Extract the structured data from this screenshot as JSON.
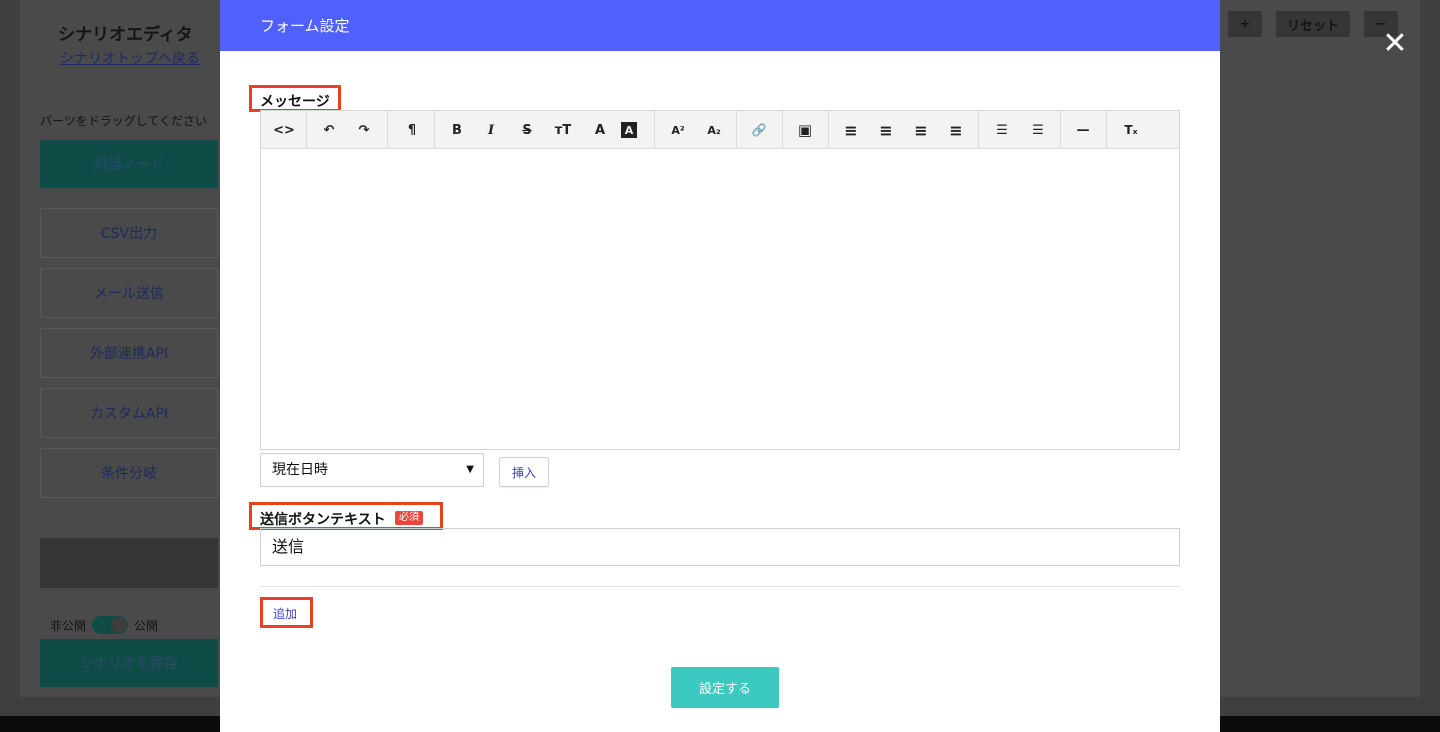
{
  "background_app": {
    "title": "シナリオエディタ",
    "back_link": "シナリオトップへ戻る",
    "parts_hint": "パーツをドラッグしてください",
    "parts": [
      {
        "label": "対話ノード"
      },
      {
        "label": "CSV出力"
      },
      {
        "label": "メール送信"
      },
      {
        "label": "外部連携API"
      },
      {
        "label": "カスタムAPI"
      },
      {
        "label": "条件分岐"
      }
    ],
    "dark_button_label": "",
    "toggle_off_label": "非公開",
    "toggle_on_label": "公開",
    "save_label": "シナリオを保存",
    "top_controls": {
      "plus": "+",
      "reset": "リセット",
      "minus": "−"
    }
  },
  "close_glyph": "✕",
  "modal": {
    "title": "フォーム設定",
    "message_label": "メッセージ",
    "toolbar_icons": [
      "code-view-icon",
      "undo-icon",
      "redo-icon",
      "paragraph-icon",
      "bold-icon",
      "italic-icon",
      "strikethrough-icon",
      "font-size-icon",
      "font-color-icon",
      "background-color-icon",
      "superscript-icon",
      "subscript-icon",
      "link-icon",
      "image-icon",
      "align-left-icon",
      "align-center-icon",
      "align-right-icon",
      "align-justify-icon",
      "unordered-list-icon",
      "ordered-list-icon",
      "horizontal-rule-icon",
      "clear-format-icon"
    ],
    "toolbar_glyphs": {
      "code": "<>",
      "undo": "↶",
      "redo": "↷",
      "paragraph": "¶",
      "bold": "B",
      "italic": "I",
      "strike": "S",
      "fontsize": "тT",
      "fontcolor": "A",
      "bgcolor": "A",
      "sup": "A²",
      "sub": "A₂",
      "link": "🔗",
      "image": "▣",
      "alignleft": "≡",
      "aligncenter": "≡",
      "alignright": "≡",
      "justify": "≡",
      "ul": "☰",
      "ol": "☰",
      "hr": "—",
      "clear": "Tₓ"
    },
    "variable_select": {
      "selected": "現在日時",
      "arrow": "▼"
    },
    "insert_label": "挿入",
    "submit_text_label": "送信ボタンテキスト",
    "required_badge": "必須",
    "submit_text_value": "送信",
    "add_label": "追加",
    "apply_label": "設定する"
  }
}
